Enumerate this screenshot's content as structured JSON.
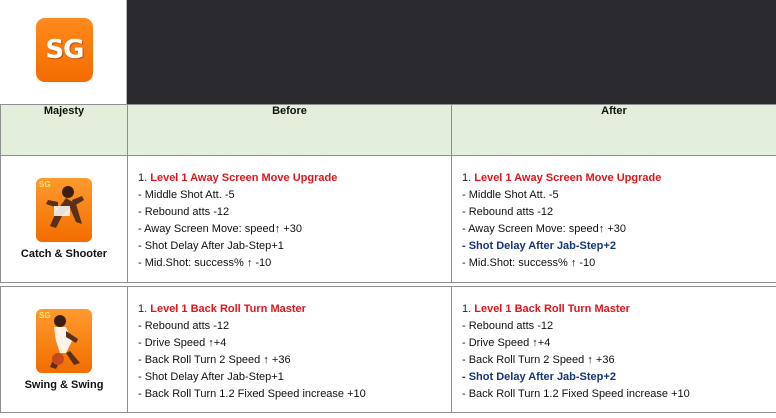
{
  "logo": {
    "text": "SG",
    "icon": "sg-logo-icon",
    "color": "#f46b00"
  },
  "table": {
    "headers": {
      "player": "Majesty",
      "before": "Before",
      "after": "After"
    },
    "rows": [
      {
        "player_name": "Catch & Shooter",
        "before": {
          "num": "1. ",
          "title": "Level 1 Away Screen Move Upgrade",
          "lines": [
            "- Middle Shot Att. -5",
            "- Rebound atts -12",
            "- Away Screen Move: speed↑ +30",
            "- Shot Delay After Jab-Step+1",
            "- Mid.Shot: success% ↑ -10"
          ]
        },
        "after": {
          "num": "1. ",
          "title": "Level 1 Away Screen Move Upgrade",
          "lines": [
            "- Middle Shot Att. -5",
            "- Rebound atts -12",
            "- Away Screen Move: speed↑ +30",
            "- Shot Delay After Jab-Step+2",
            "- Mid.Shot: success% ↑ -10"
          ]
        }
      },
      {
        "player_name": "Swing & Swing",
        "before": {
          "num": "1. ",
          "title": "Level 1 Back Roll Turn Master",
          "lines": [
            "- Rebound atts -12",
            "- Drive Speed ↑+4",
            "- Back Roll Turn 2 Speed ↑ +36",
            "- Shot Delay After Jab-Step+1",
            "- Back Roll Turn 1.2 Fixed Speed increase +10"
          ]
        },
        "after": {
          "num": "1. ",
          "title": "Level 1 Back Roll Turn Master",
          "lines": [
            "- Rebound atts -12",
            "- Drive Speed ↑+4",
            "- Back Roll Turn 2 Speed ↑ +36",
            "- Shot Delay After Jab-Step+2",
            "- Back Roll Turn 1.2 Fixed Speed increase +10"
          ]
        }
      }
    ]
  },
  "colors": {
    "header_bg": "#e3efda",
    "title_red": "#e4141b",
    "highlight_navy": "#16357a",
    "banner": "#2a2a2e"
  }
}
